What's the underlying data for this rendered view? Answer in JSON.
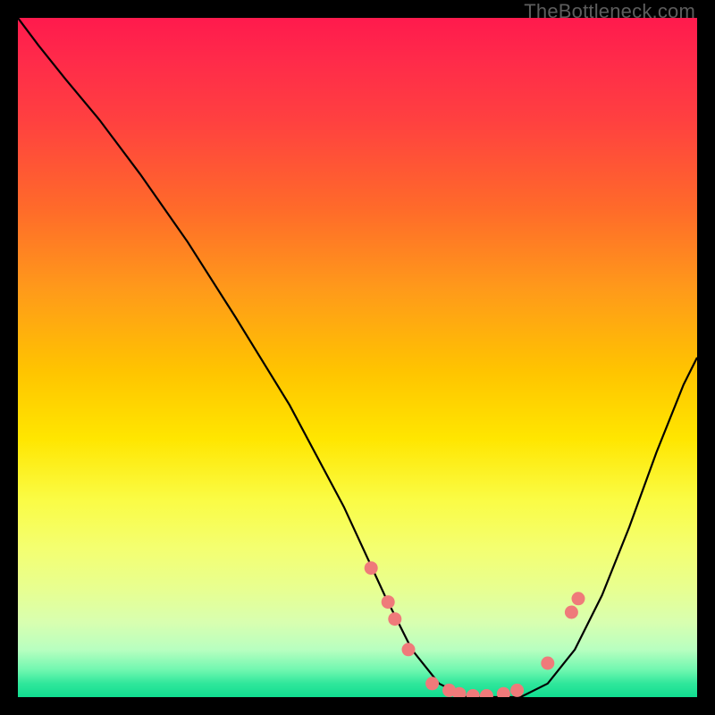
{
  "watermark": "TheBottleneck.com",
  "colors": {
    "curve_stroke": "#000000",
    "dot_fill": "#ef7a7a",
    "dot_stroke": "#d85a5a"
  },
  "chart_data": {
    "type": "line",
    "title": "",
    "xlabel": "",
    "ylabel": "",
    "xlim": [
      0,
      100
    ],
    "ylim": [
      0,
      100
    ],
    "x": [
      0,
      3,
      7,
      12,
      18,
      25,
      32,
      40,
      48,
      54,
      58,
      62,
      66,
      70,
      74,
      78,
      82,
      86,
      90,
      94,
      98,
      100
    ],
    "y": [
      100,
      96,
      91,
      85,
      77,
      67,
      56,
      43,
      28,
      15,
      7,
      2,
      0,
      0,
      0,
      2,
      7,
      15,
      25,
      36,
      46,
      50
    ],
    "points": [
      {
        "x": 52.0,
        "y": 19.0
      },
      {
        "x": 54.5,
        "y": 14.0
      },
      {
        "x": 55.5,
        "y": 11.5
      },
      {
        "x": 57.5,
        "y": 7.0
      },
      {
        "x": 61.0,
        "y": 2.0
      },
      {
        "x": 63.5,
        "y": 1.0
      },
      {
        "x": 65.0,
        "y": 0.5
      },
      {
        "x": 67.0,
        "y": 0.2
      },
      {
        "x": 69.0,
        "y": 0.2
      },
      {
        "x": 71.5,
        "y": 0.5
      },
      {
        "x": 73.5,
        "y": 1.0
      },
      {
        "x": 78.0,
        "y": 5.0
      },
      {
        "x": 81.5,
        "y": 12.5
      },
      {
        "x": 82.5,
        "y": 14.5
      }
    ]
  }
}
